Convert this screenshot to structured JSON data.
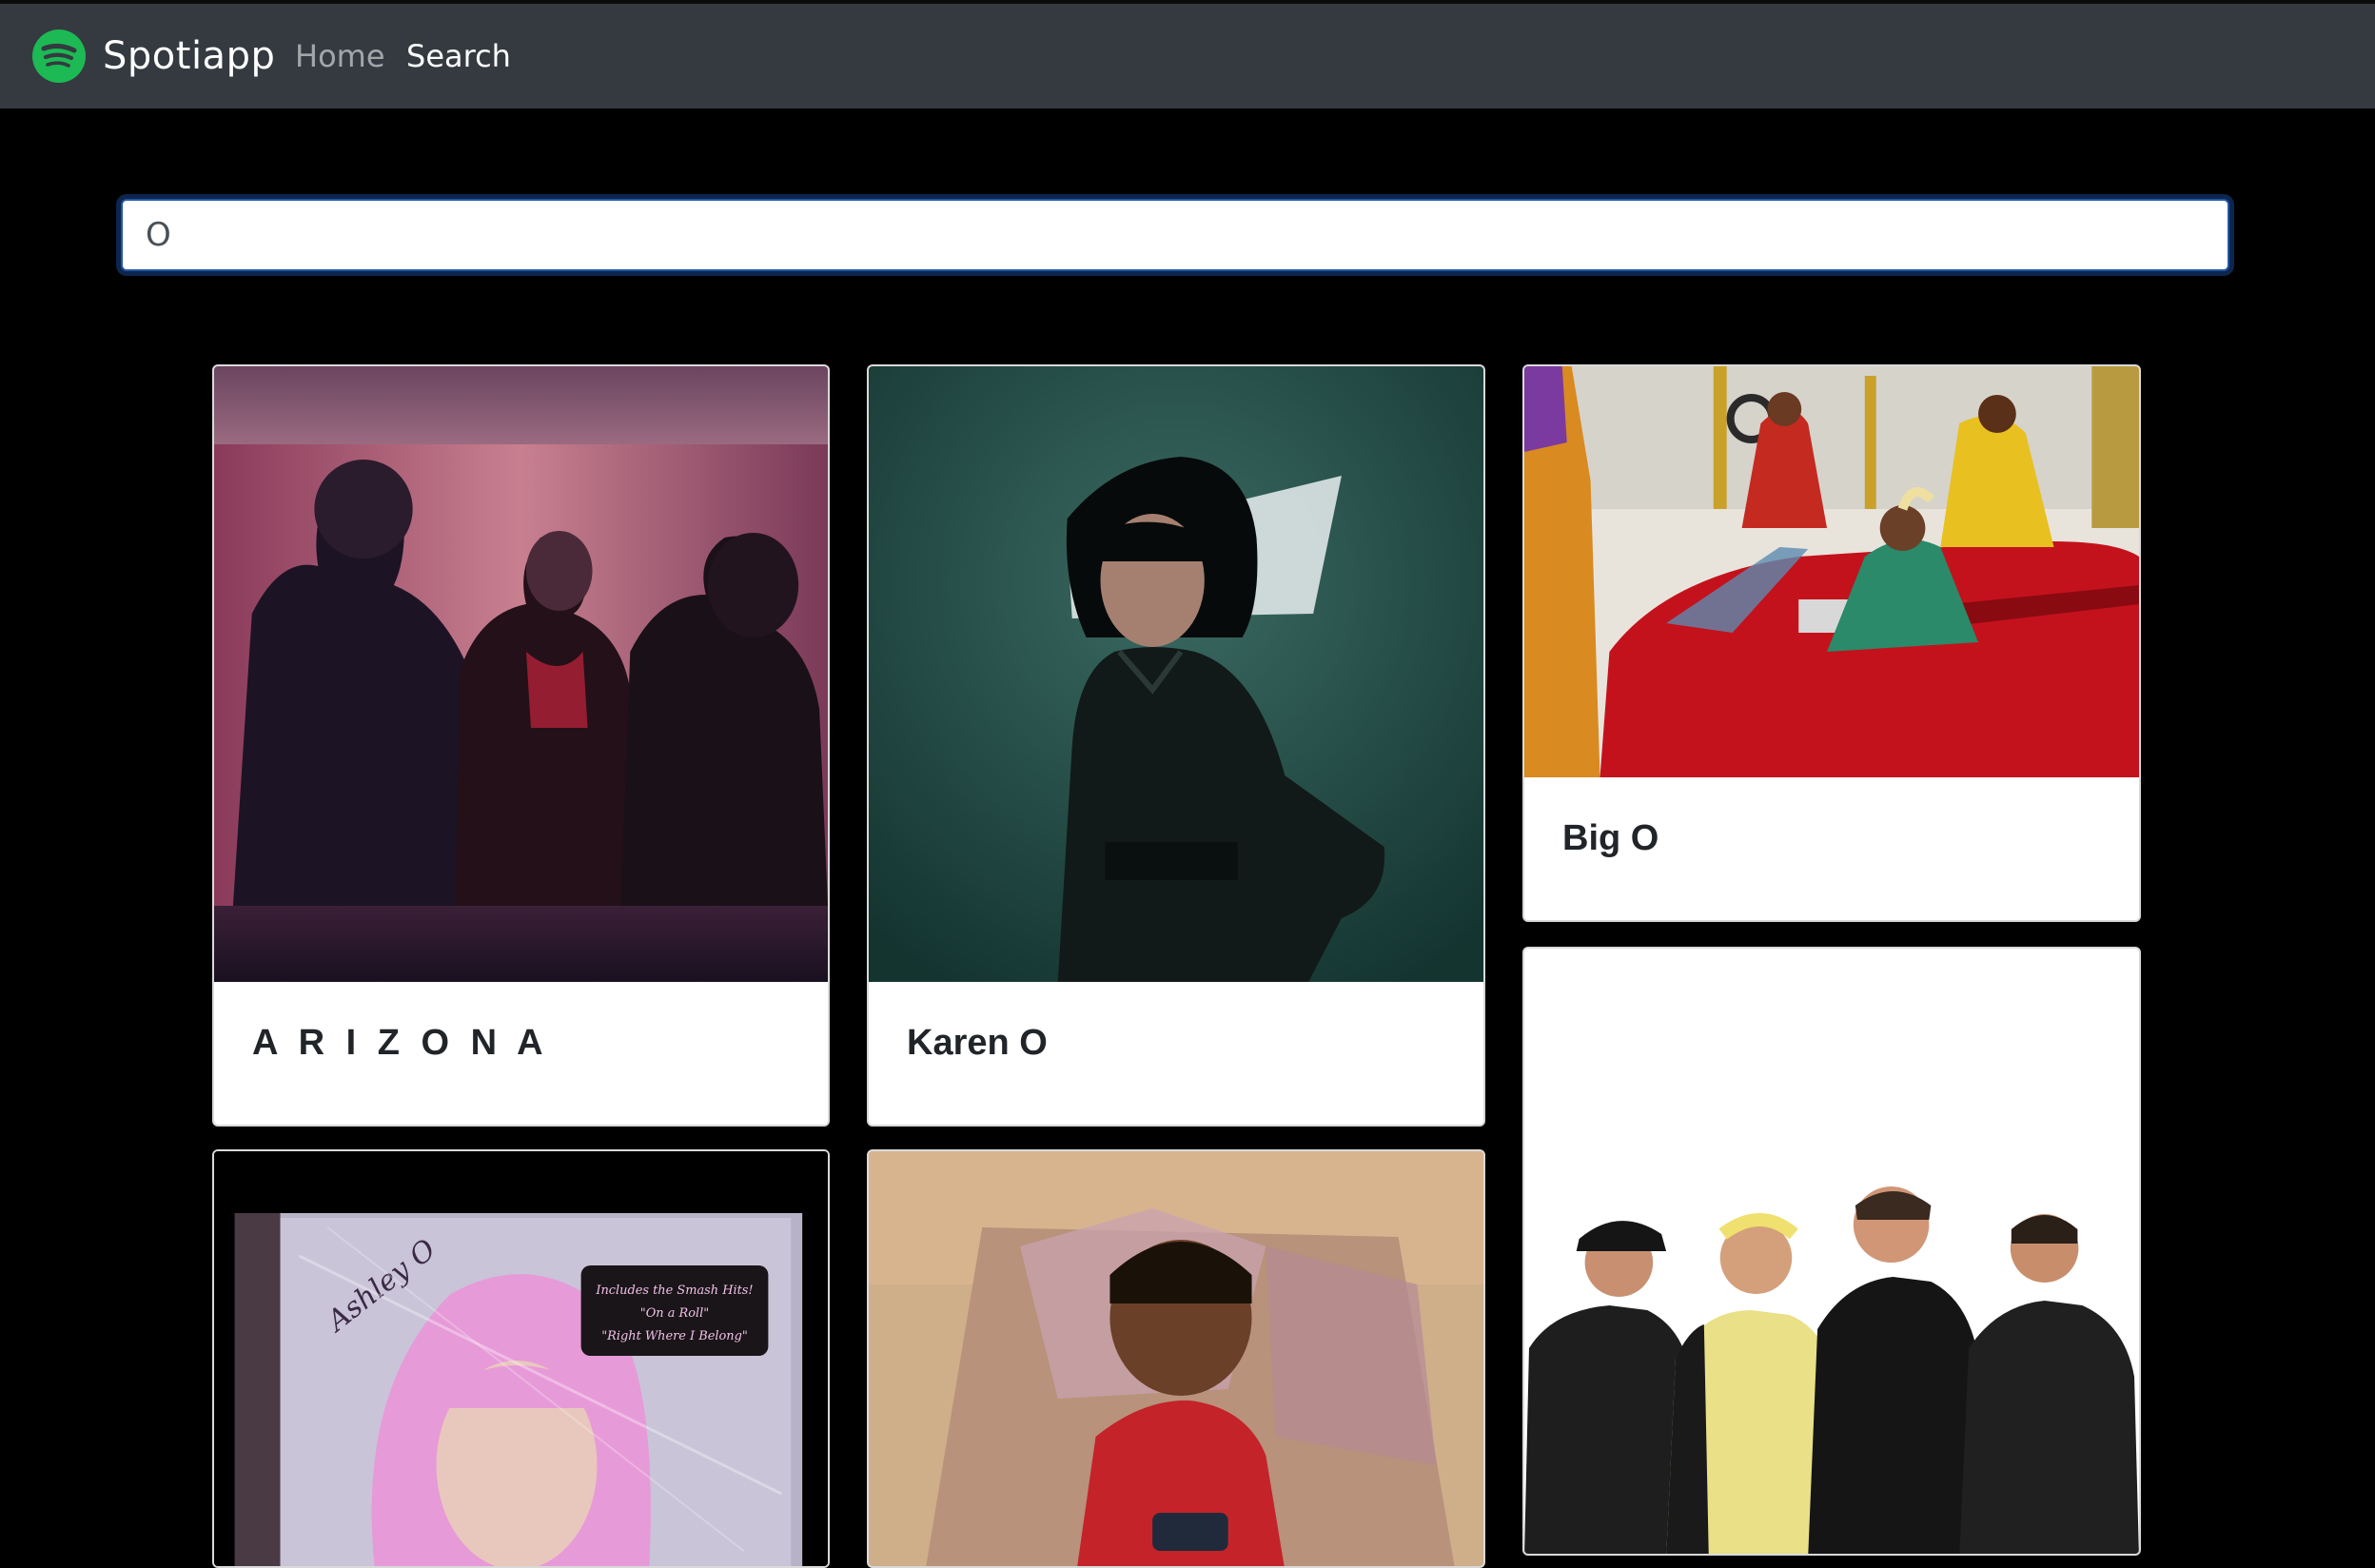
{
  "navbar": {
    "brand": "Spotiapp",
    "links": [
      "Home",
      "Search"
    ]
  },
  "search": {
    "value": "O",
    "placeholder": ""
  },
  "artists": [
    {
      "name": "A R I Z O N A"
    },
    {
      "name": "Karen O"
    },
    {
      "name": "Big O"
    },
    {
      "name": ""
    },
    {
      "name": ""
    },
    {
      "name": ""
    }
  ],
  "album_sticker": [
    "Includes the Smash Hits!",
    "\"On a Roll\"",
    "\"Right Where I Belong\""
  ],
  "album_text": "Ashley O",
  "colors": {
    "navbar_bg": "#343a40",
    "page_bg": "#000000",
    "spotify_green": "#1db954"
  }
}
